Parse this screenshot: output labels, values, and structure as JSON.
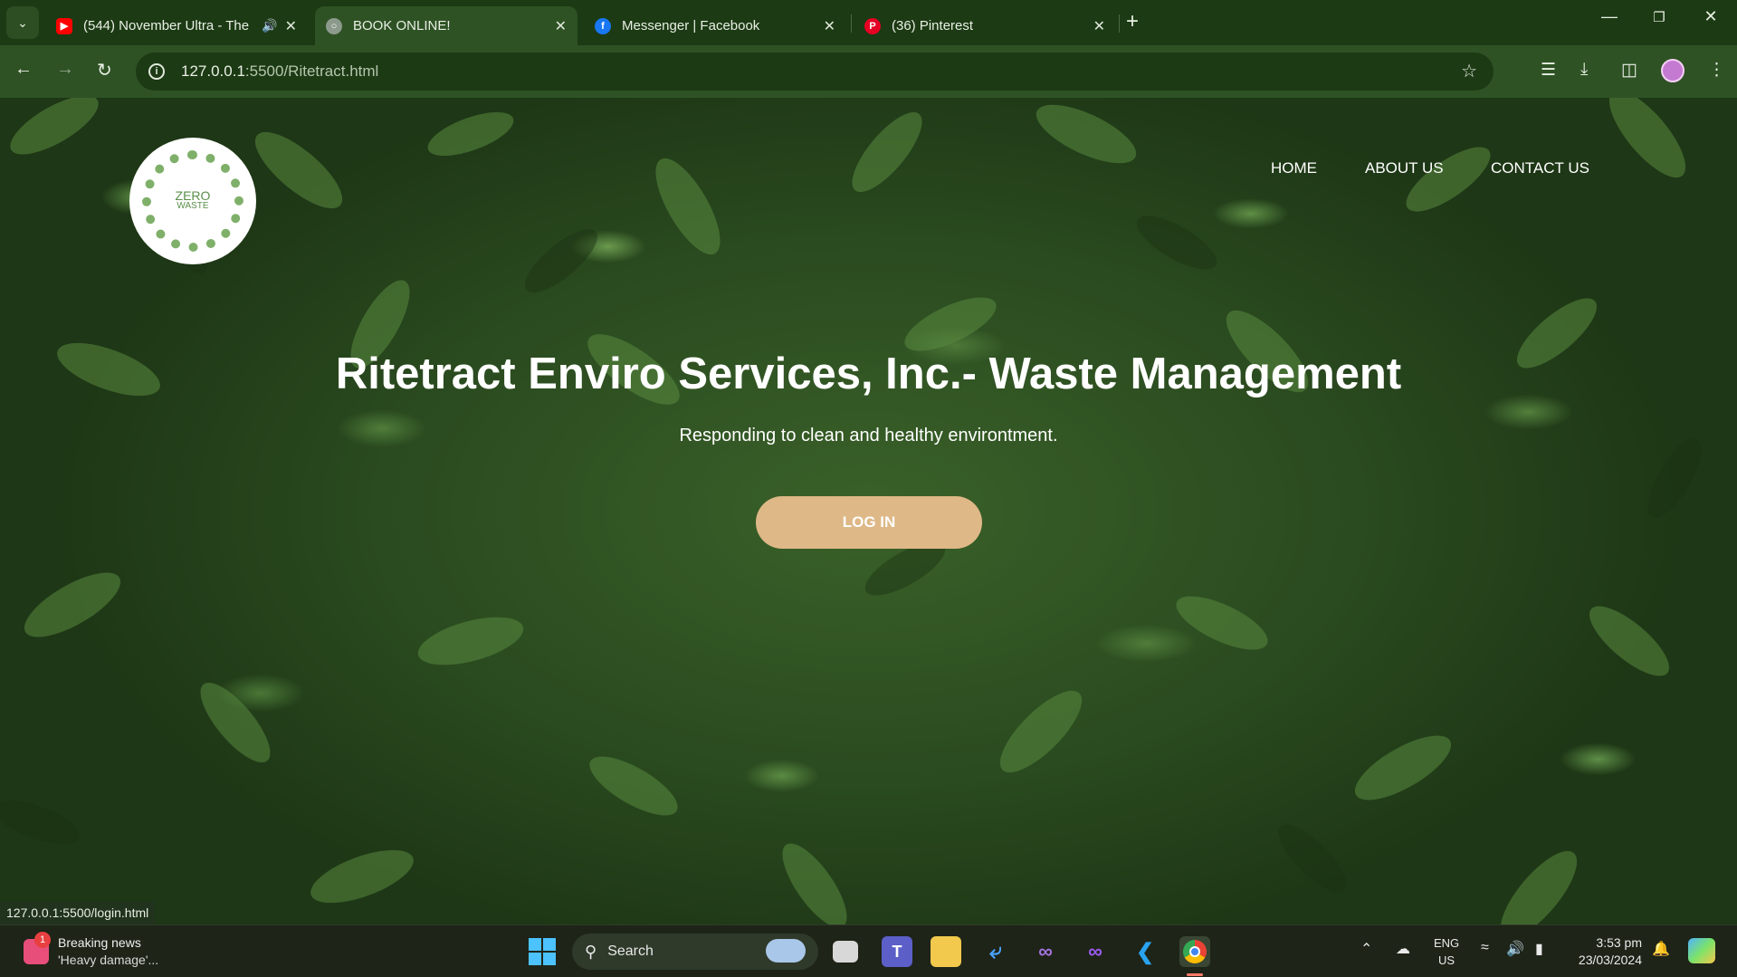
{
  "browser": {
    "tabs": [
      {
        "title": "(544) November Ultra - The",
        "favicon": "youtube-icon",
        "color": "#ff0000"
      },
      {
        "title": "BOOK ONLINE!",
        "favicon": "globe-icon",
        "color": "#9aa89a"
      },
      {
        "title": "Messenger | Facebook",
        "favicon": "facebook-icon",
        "color": "#1877f2"
      },
      {
        "title": "(36) Pinterest",
        "favicon": "pinterest-icon",
        "color": "#e60023"
      }
    ],
    "new_tab": "+",
    "url_host": "127.0.0.1",
    "url_path": ":5500/Ritetract.html",
    "status_url": "127.0.0.1:5500/login.html"
  },
  "page": {
    "logo": {
      "line1": "ZERO",
      "line2": "WASTE"
    },
    "nav": {
      "home": "HOME",
      "about": "ABOUT US",
      "contact": "CONTACT US"
    },
    "hero": {
      "title": "Ritetract Enviro Services, Inc.- Waste Management",
      "subtitle": "Responding to clean and healthy environtment.",
      "login": "LOG IN"
    },
    "colors": {
      "button": "#deb887",
      "chrome": "#2e5224"
    }
  },
  "taskbar": {
    "news": {
      "badge": "1",
      "title": "Breaking news",
      "subtitle": "'Heavy damage'..."
    },
    "search_label": "Search",
    "lang": {
      "top": "ENG",
      "bottom": "US"
    },
    "clock": {
      "time": "3:53 pm",
      "date": "23/03/2024"
    }
  }
}
